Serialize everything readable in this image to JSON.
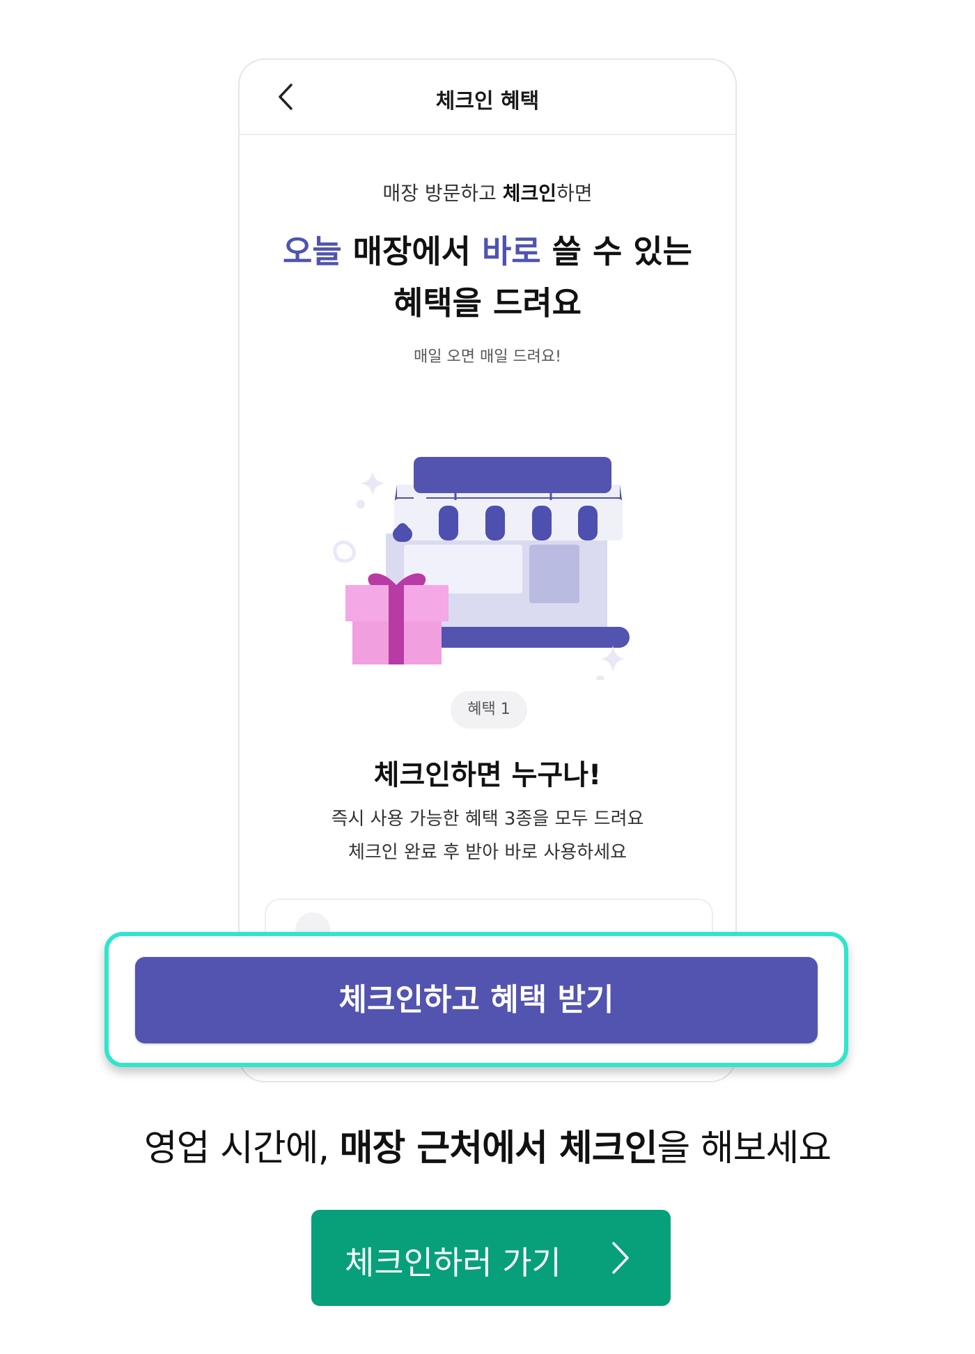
{
  "phone": {
    "appbar": {
      "title": "체크인 혜택"
    },
    "intro": {
      "sub_normal": "매장 방문하고 ",
      "sub_bold": "체크인",
      "sub_tail": "하면",
      "headline_accent1": "오늘",
      "headline_mid1": " 매장에서 ",
      "headline_accent2": "바로",
      "headline_end1": " 쓸 수 있는",
      "headline_line2": "혜택을 드려요",
      "note": "매일 오면 매일 드려요!"
    },
    "benefit": {
      "pill": "혜택 1",
      "title": "체크인하면 누구나!",
      "desc_line1": "즉시 사용 가능한 혜택 3종을 모두 드려요",
      "desc_line2": "체크인 완료 후 받아 바로 사용하세요"
    },
    "cta_label": "체크인하고 혜택 받기"
  },
  "caption": {
    "part1": "영업 시간에, ",
    "bold": "매장 근처에서 체크인",
    "part2": "을 해보세요"
  },
  "go_button": {
    "label": "체크인하러 가기"
  },
  "colors": {
    "accent": "#4f53b0",
    "cta": "#5254b0",
    "highlight_border": "#2ee6cc",
    "go_button": "#07a07a",
    "gift": "#f29fe0"
  },
  "icons": [
    "chevron-left-icon",
    "store-illustration",
    "gift-icon",
    "sparkle-icon",
    "chevron-right-icon"
  ]
}
